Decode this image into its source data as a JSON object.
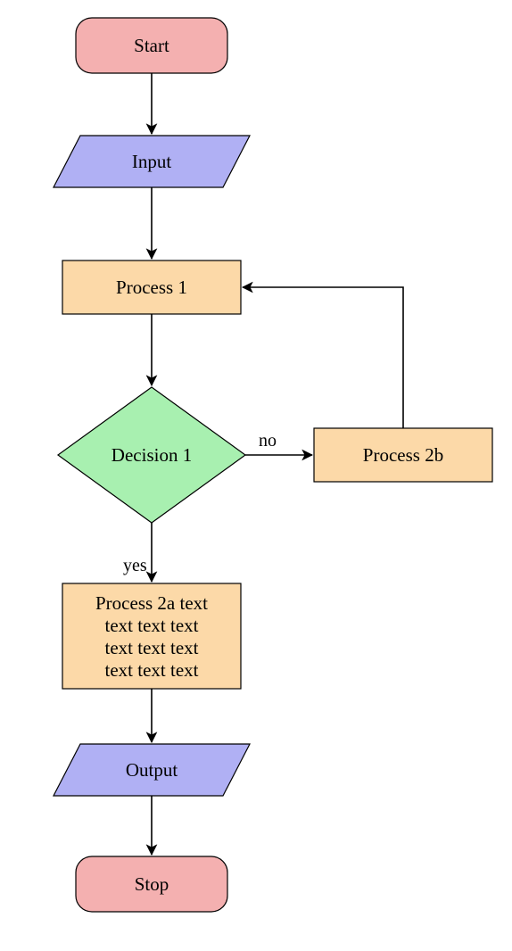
{
  "chart_data": {
    "type": "flowchart",
    "nodes": [
      {
        "id": "start",
        "kind": "startstop",
        "label": "Start"
      },
      {
        "id": "input",
        "kind": "io",
        "label": "Input"
      },
      {
        "id": "proc1",
        "kind": "process",
        "label": "Process 1"
      },
      {
        "id": "dec1",
        "kind": "decision",
        "label": "Decision 1"
      },
      {
        "id": "proc2a",
        "kind": "process",
        "label_lines": [
          "Process 2a text",
          "text text text",
          "text text text",
          "text text text"
        ]
      },
      {
        "id": "proc2b",
        "kind": "process",
        "label": "Process 2b"
      },
      {
        "id": "output",
        "kind": "io",
        "label": "Output"
      },
      {
        "id": "stop",
        "kind": "startstop",
        "label": "Stop"
      }
    ],
    "edges": [
      {
        "from": "start",
        "to": "input"
      },
      {
        "from": "input",
        "to": "proc1"
      },
      {
        "from": "proc1",
        "to": "dec1"
      },
      {
        "from": "dec1",
        "to": "proc2a",
        "label": "yes"
      },
      {
        "from": "dec1",
        "to": "proc2b",
        "label": "no"
      },
      {
        "from": "proc2b",
        "to": "proc1"
      },
      {
        "from": "proc2a",
        "to": "output"
      },
      {
        "from": "output",
        "to": "stop"
      }
    ]
  },
  "colors": {
    "startstop_fill": "#f4b0b0",
    "io_fill": "#b0b0f4",
    "process_fill": "#fcd9a8",
    "decision_fill": "#a8f0b0",
    "stroke": "#000000"
  },
  "labels": {
    "yes": "yes",
    "no": "no"
  }
}
